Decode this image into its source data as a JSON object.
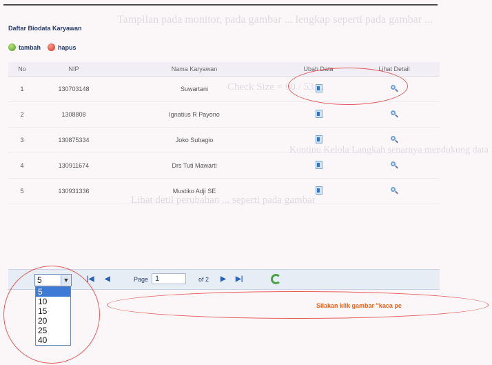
{
  "header": {
    "title": "Daftar Biodata Karyawan"
  },
  "toolbar": {
    "add_label": "tambah",
    "delete_label": "hapus"
  },
  "columns": [
    "No",
    "NIP",
    "Nama Karyawan",
    "Ubah Data",
    "Lihat Detail"
  ],
  "rows": [
    {
      "no": "1",
      "nip": "130703148",
      "nama": "Suwartani"
    },
    {
      "no": "2",
      "nip": "1308808",
      "nama": "Ignatius R Payono"
    },
    {
      "no": "3",
      "nip": "130875334",
      "nama": "Joko Subagio"
    },
    {
      "no": "4",
      "nip": "130911674",
      "nama": "Drs Tuti Mawarti"
    },
    {
      "no": "5",
      "nip": "130931336",
      "nama": "Mustiko Adji SE"
    }
  ],
  "pager": {
    "rows_per_page": "5",
    "page_label": "Page",
    "page_value": "1",
    "of_label": "of 2",
    "options": [
      "5",
      "10",
      "15",
      "20",
      "25",
      "40"
    ]
  },
  "hint_text": "Silakan klik gambar \"kaca pe",
  "icons": {
    "add": "add-icon",
    "delete": "delete-icon",
    "edit": "edit-icon",
    "detail": "magnifier-icon",
    "first": "first-page-icon",
    "prev": "prev-page-icon",
    "next": "next-page-icon",
    "last": "last-page-icon",
    "refresh": "refresh-icon"
  },
  "colors": {
    "title": "#22376b",
    "hint": "#e2651e",
    "highlight_oval": "#dc2828",
    "selected_option": "#3d7bd6"
  },
  "background_text": [
    "Tampilan pada monitor, pada gambar ... lengkap seperti pada gambar ...",
    "Check Size = 60 / 53 ...",
    "Kontinu Kelola Langkah senarnya mendukung data ...",
    "Lihat detil perubahan ... seperti pada gambar"
  ]
}
